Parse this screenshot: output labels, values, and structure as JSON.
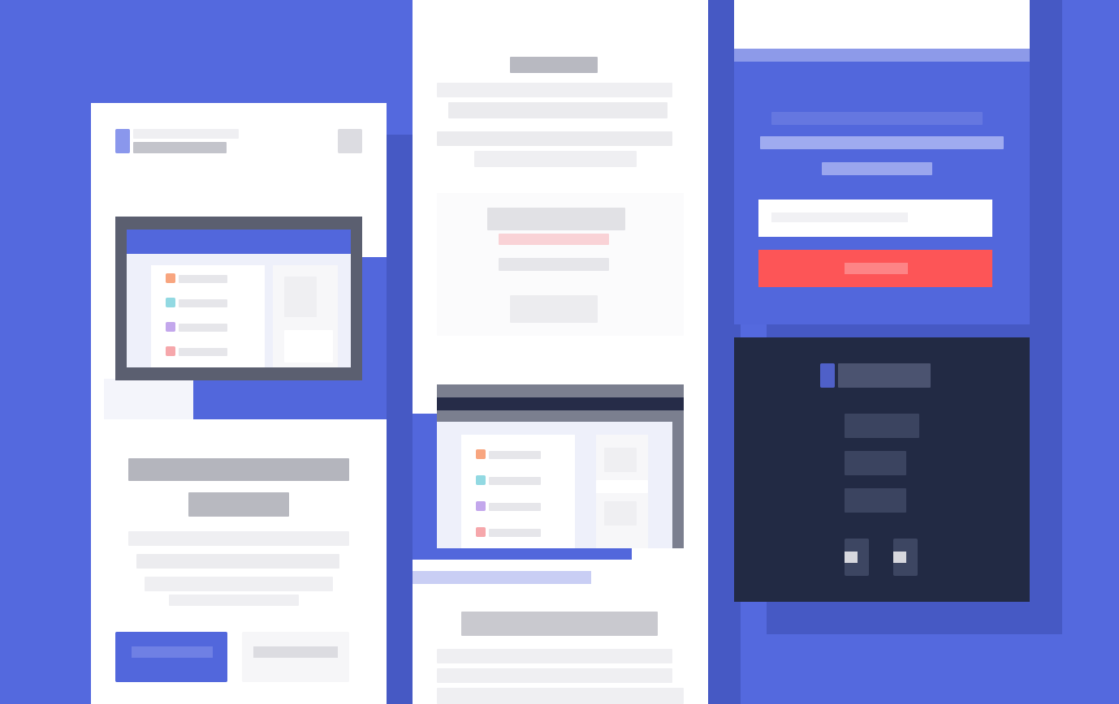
{
  "colors": {
    "background": "#5469de",
    "panel": "#ffffff",
    "shadow": "#4659c4",
    "accent": "#5267dc",
    "cta": "#fd5557",
    "footer": "#222a44",
    "swatch_orange": "#f8a57f",
    "swatch_teal": "#92d9e2",
    "swatch_purple": "#c3a7ec",
    "swatch_pink": "#f6a7ab"
  },
  "icons": {
    "logo": "logo-icon",
    "menu": "menu-icon",
    "social_1": "social-icon",
    "social_2": "social-icon"
  },
  "left_panel": {
    "brand": "",
    "headline": "",
    "subheadline": "",
    "body": "",
    "primary_button": "",
    "secondary_button": ""
  },
  "middle_panel": {
    "kicker": "",
    "intro": "",
    "feature_title": "",
    "feature_link": "",
    "feature_meta": "",
    "feature_tag": "",
    "section_title": "",
    "section_body": ""
  },
  "right_panel": {
    "cta_heading": "",
    "email_placeholder": "",
    "submit_button": "",
    "footer_brand": "",
    "footer_links": [
      "",
      "",
      ""
    ]
  }
}
